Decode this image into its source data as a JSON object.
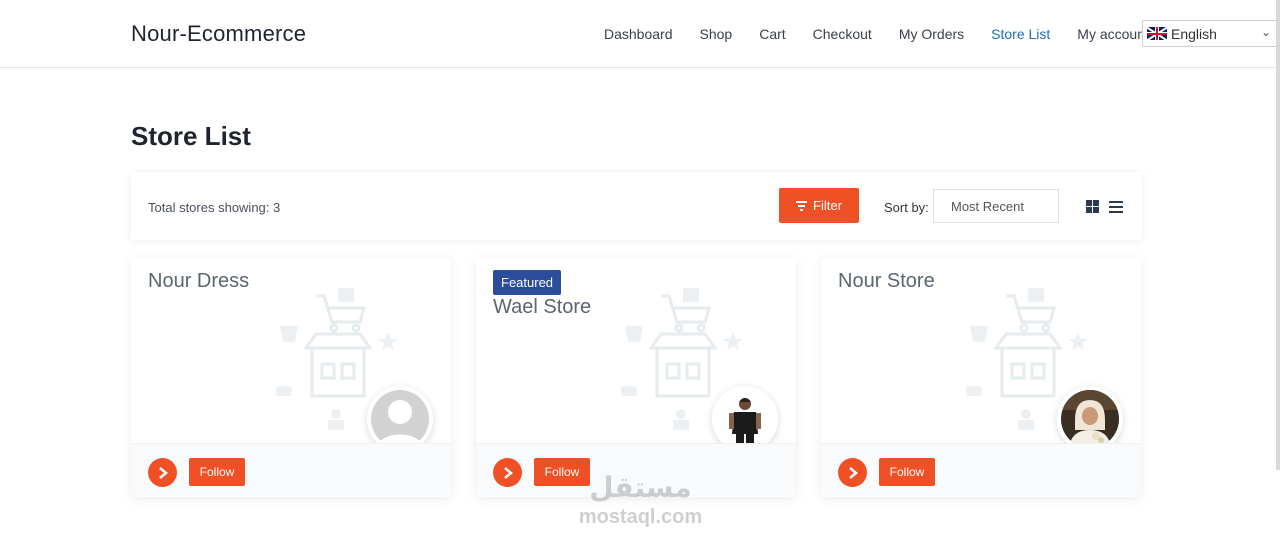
{
  "header": {
    "brand": "Nour-Ecommerce",
    "nav": [
      "Dashboard",
      "Shop",
      "Cart",
      "Checkout",
      "My Orders",
      "Store List",
      "My account"
    ],
    "active_nav": "Store List",
    "language": {
      "label": "English",
      "icon": "uk-flag-icon"
    }
  },
  "page": {
    "title": "Store List"
  },
  "toolbar": {
    "total_text": "Total stores showing: 3",
    "filter_label": "Filter",
    "sort_label": "Sort by:",
    "sort_value": "Most Recent",
    "view_icons": [
      "grid-view-icon",
      "list-view-icon"
    ]
  },
  "stores": [
    {
      "name": "Nour Dress",
      "featured": false,
      "avatar": "default-avatar",
      "follow_label": "Follow"
    },
    {
      "name": "Wael Store",
      "featured": true,
      "featured_label": "Featured",
      "avatar": "man-photo",
      "follow_label": "Follow"
    },
    {
      "name": "Nour Store",
      "featured": false,
      "avatar": "woman-photo",
      "follow_label": "Follow"
    }
  ],
  "watermark": {
    "arabic": "مستقل",
    "latin": "mostaql.com"
  },
  "colors": {
    "accent": "#f05025",
    "featured_badge": "#2b4d9b",
    "active_link": "#1f6fb2"
  }
}
